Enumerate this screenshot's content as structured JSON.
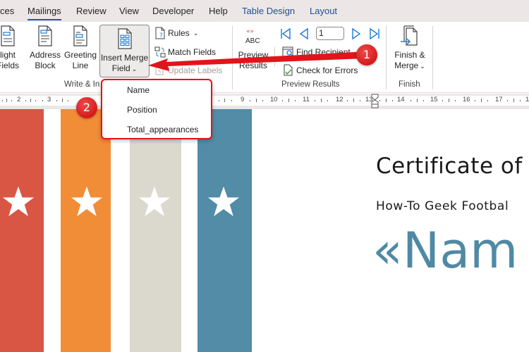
{
  "tabs": [
    {
      "label": "ces",
      "active": false
    },
    {
      "label": "Mailings",
      "active": true
    },
    {
      "label": "Review",
      "active": false
    },
    {
      "label": "View",
      "active": false
    },
    {
      "label": "Developer",
      "active": false
    },
    {
      "label": "Help",
      "active": false
    },
    {
      "label": "Table Design",
      "active": false,
      "contextual": true
    },
    {
      "label": "Layout",
      "active": false,
      "contextual": true
    }
  ],
  "ribbon": {
    "write_insert": {
      "highlight_fields": [
        "light",
        "Fields"
      ],
      "address_block": [
        "Address",
        "Block"
      ],
      "greeting_line": [
        "Greeting",
        "Line"
      ],
      "insert_merge_field": [
        "Insert Merge",
        "Field"
      ],
      "rules": "Rules",
      "match_fields": "Match Fields",
      "update_labels": "Update Labels",
      "group_label": "Write & In"
    },
    "preview": {
      "abc_label": "ABC",
      "preview_results": [
        "Preview",
        "Results"
      ],
      "record_number": "1",
      "find_recipient": "Find Recipient",
      "check_errors": "Check for Errors",
      "group_label": "Preview Results"
    },
    "finish": {
      "finish_merge": [
        "Finish &",
        "Merge"
      ],
      "group_label": "Finish"
    }
  },
  "ruler": {
    "left_ticks": [
      "2",
      "3"
    ],
    "right_ticks": [
      "9",
      "10",
      "11",
      "12",
      "13",
      "14",
      "15",
      "16",
      "17",
      "1"
    ]
  },
  "dropdown": {
    "items": [
      "Name",
      "Position",
      "Total_appearances"
    ]
  },
  "annotations": {
    "badge1": "1",
    "badge2": "2",
    "highlight_color": "#e2141b"
  },
  "document": {
    "title": "Certificate of",
    "subtitle": "How-To Geek Footbal",
    "merge_field": "«Nam",
    "stripe_colors": [
      "#d95645",
      "#f18d36",
      "#dbd9ce",
      "#528ca7"
    ]
  }
}
